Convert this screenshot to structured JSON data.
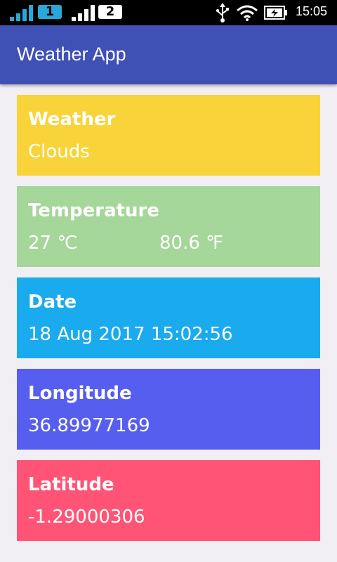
{
  "status_bar": {
    "sim1": "1",
    "sim2": "2",
    "time": "15:05",
    "icons": [
      "signal-icon",
      "usb-icon",
      "wifi-icon",
      "battery-charging-icon"
    ],
    "colors": {
      "sim1": "#2aa6d9",
      "background": "#000000"
    }
  },
  "app_bar": {
    "title": "Weather App",
    "color": "#3f51b5"
  },
  "cards": {
    "weather": {
      "title": "Weather",
      "value": "Clouds",
      "color": "#f8d43a"
    },
    "temperature": {
      "title": "Temperature",
      "celsius": "27 ℃",
      "fahrenheit": "80.6 ℉",
      "color": "#a5d69a"
    },
    "date": {
      "title": "Date",
      "value": "18 Aug 2017 15:02:56",
      "color": "#1aaaee"
    },
    "longitude": {
      "title": "Longitude",
      "value": "36.89977169",
      "color": "#565ef0"
    },
    "latitude": {
      "title": "Latitude",
      "value": "-1.29000306",
      "color": "#ff5475"
    }
  }
}
